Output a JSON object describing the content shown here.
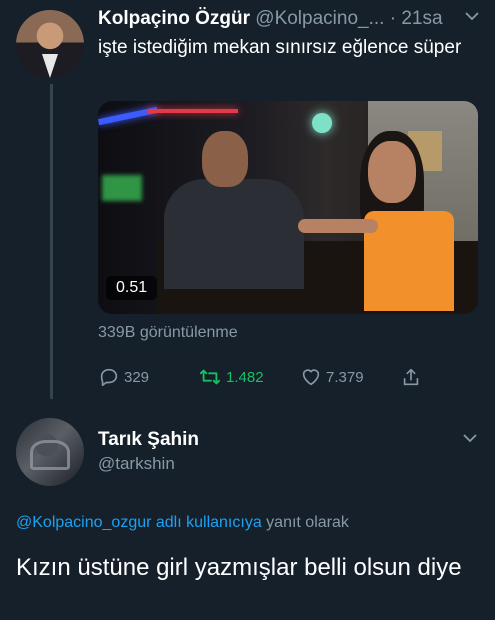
{
  "tweet1": {
    "name": "Kolpaçino Özgür",
    "handle": "@Kolpacino_...",
    "separator": "·",
    "time": "21sa",
    "text": "işte istediğim mekan sınırsız eğlence süper",
    "video_duration": "0.51",
    "views": "339B görüntülenme",
    "reply_count": "329",
    "retweet_count": "1.482",
    "like_count": "7.379"
  },
  "tweet2": {
    "name": "Tarık Şahin",
    "handle": "@tarkshin",
    "reply_to_handle": "@Kolpacino_ozgur adlı kullanıcıya",
    "reply_to_suffix": "yanıt olarak",
    "text": "Kızın üstüne girl yazmışlar belli olsun diye"
  },
  "icons": {
    "reply": "reply-icon",
    "retweet": "retweet-icon",
    "like": "heart-icon",
    "share": "share-icon",
    "menu": "chevron-down-icon"
  },
  "colors": {
    "background": "#15202b",
    "secondary_text": "#8899a6",
    "link": "#1da1f2",
    "retweet_active": "#17bf63"
  }
}
